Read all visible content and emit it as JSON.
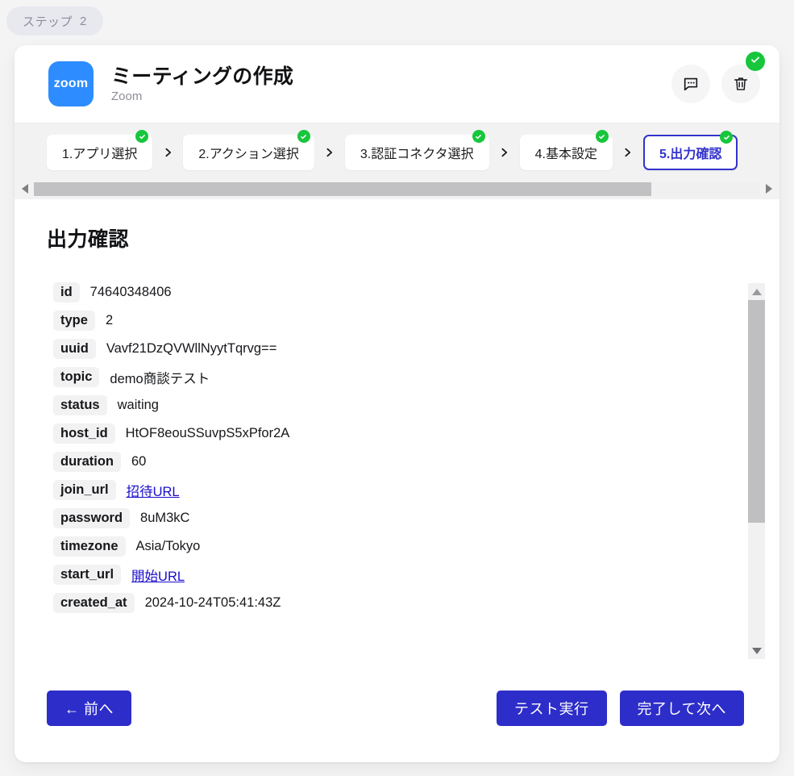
{
  "step_chip": {
    "label": "ステップ",
    "number": "2"
  },
  "header": {
    "logo_text": "zoom",
    "logo_icon": "zoom-app-logo",
    "title": "ミーティングの作成",
    "subtitle": "Zoom",
    "comment_icon": "comment-icon",
    "delete_icon": "trash-icon",
    "status_icon": "check-circle-icon",
    "accent_color": "#2d8cff",
    "status_color": "#17c63c"
  },
  "tabs": {
    "separator": "❯",
    "items": [
      {
        "label": "1.アプリ選択",
        "completed": true,
        "active": false
      },
      {
        "label": "2.アクション選択",
        "completed": true,
        "active": false
      },
      {
        "label": "3.認証コネクタ選択",
        "completed": true,
        "active": false
      },
      {
        "label": "4.基本設定",
        "completed": true,
        "active": false
      },
      {
        "label": "5.出力確認",
        "completed": true,
        "active": true
      }
    ],
    "active_color": "#3333cc"
  },
  "hscrollbar": {
    "left_arrow_icon": "caret-left-icon",
    "right_arrow_icon": "caret-right-icon",
    "thumb_percent": 85
  },
  "vscrollbar": {
    "up_arrow_icon": "caret-up-icon",
    "down_arrow_icon": "caret-down-icon",
    "thumb_percent": 65
  },
  "main": {
    "section_title": "出力確認",
    "rows": [
      {
        "key": "id",
        "value": "74640348406",
        "is_link": false
      },
      {
        "key": "type",
        "value": "2",
        "is_link": false
      },
      {
        "key": "uuid",
        "value": "Vavf21DzQVWllNyytTqrvg==",
        "is_link": false
      },
      {
        "key": "topic",
        "value": "demo商談テスト",
        "is_link": false
      },
      {
        "key": "status",
        "value": "waiting",
        "is_link": false
      },
      {
        "key": "host_id",
        "value": "HtOF8eouSSuvpS5xPfor2A",
        "is_link": false
      },
      {
        "key": "duration",
        "value": "60",
        "is_link": false
      },
      {
        "key": "join_url",
        "value": "招待URL",
        "is_link": true
      },
      {
        "key": "password",
        "value": "8uM3kC",
        "is_link": false
      },
      {
        "key": "timezone",
        "value": "Asia/Tokyo",
        "is_link": false
      },
      {
        "key": "start_url",
        "value": "開始URL",
        "is_link": true
      },
      {
        "key": "created_at",
        "value": "2024-10-24T05:41:43Z",
        "is_link": false
      }
    ]
  },
  "footer": {
    "back_label": "← 前へ",
    "test_run_label": "テスト実行",
    "complete_label": "完了して次へ",
    "button_color": "#2d2dc9"
  }
}
